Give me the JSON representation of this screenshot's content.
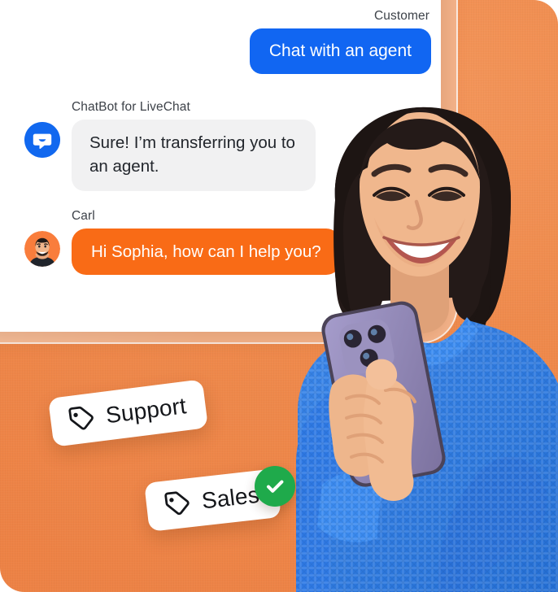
{
  "scene": {
    "background_color": "#ef8a4c",
    "card_frame_color": "#f6b58c",
    "card_color": "#ffffff"
  },
  "chat": {
    "messages": [
      {
        "author": "Customer",
        "text": "Chat with an agent",
        "side": "right",
        "bubble_color": "#1166f2",
        "text_color": "#ffffff",
        "avatar": null
      },
      {
        "author": "ChatBot for LiveChat",
        "text": "Sure! I’m transferring you to an agent.",
        "side": "left",
        "bubble_color": "#f1f1f2",
        "text_color": "#22262c",
        "avatar": "chatbot-logo-icon"
      },
      {
        "author": "Carl",
        "text": "Hi Sophia, how can I help you?",
        "side": "left",
        "bubble_color": "#f96b16",
        "text_color": "#ffffff",
        "avatar": "agent-photo-avatar"
      }
    ]
  },
  "tags": [
    {
      "label": "Support",
      "icon": "tag-icon",
      "color": "#ffffff",
      "verified": false
    },
    {
      "label": "Sales",
      "icon": "tag-icon",
      "color": "#ffffff",
      "verified": true
    }
  ],
  "badge": {
    "icon": "check-icon",
    "color": "#1faa4b"
  },
  "person": {
    "description": "Smiling woman in blue knit sweater holding a purple smartphone",
    "sweater_color": "#2f7ae5",
    "phone_color": "#8d85b8",
    "hair_color": "#241a18",
    "skin_color": "#e8b28c"
  }
}
